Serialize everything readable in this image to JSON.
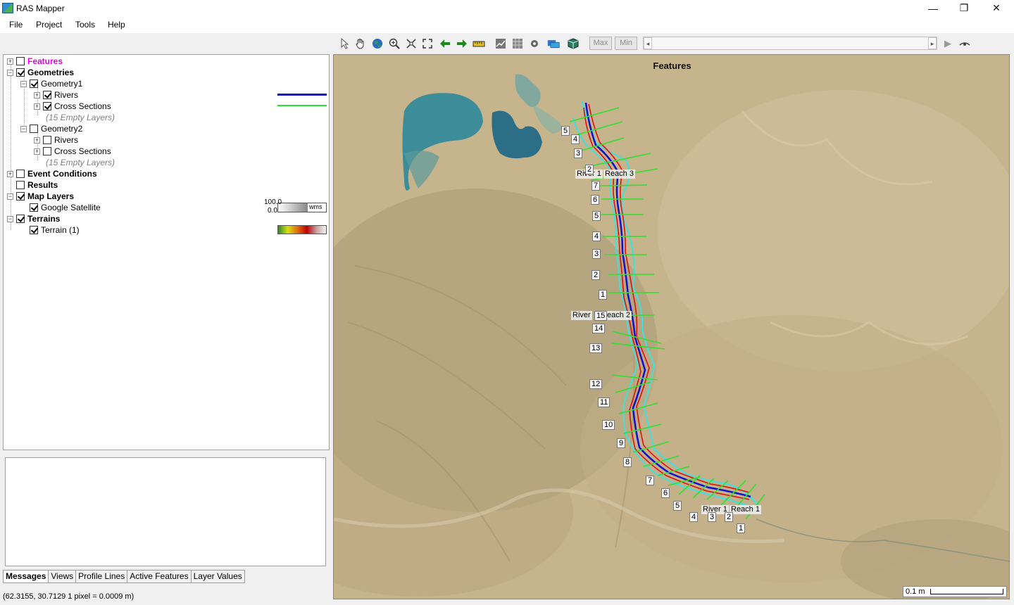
{
  "window": {
    "title": "RAS Mapper",
    "minimize": "—",
    "maximize": "❐",
    "close": "✕"
  },
  "menu": [
    "File",
    "Project",
    "Tools",
    "Help"
  ],
  "toolbar": {
    "max_label": "Max",
    "min_label": "Min",
    "icons": [
      "pointer-icon",
      "pan-hand-icon",
      "globe-icon",
      "zoom-in-icon",
      "zoom-extents-icon",
      "full-extent-icon",
      "back-arrow-icon",
      "forward-arrow-icon",
      "measure-icon",
      "profile-icon",
      "raster-icon",
      "settings-icon",
      "layer-icon",
      "cube-icon"
    ]
  },
  "tree": {
    "features": "Features",
    "geometries": "Geometries",
    "geometry1": "Geometry1",
    "g1_rivers": "Rivers",
    "g1_cross_sections": "Cross Sections",
    "g1_empty": "(15 Empty Layers)",
    "geometry2": "Geometry2",
    "g2_rivers": "Rivers",
    "g2_cross_sections": "Cross Sections",
    "g2_empty": "(15 Empty Layers)",
    "event_conditions": "Event Conditions",
    "results": "Results",
    "map_layers": "Map Layers",
    "google_satellite": "Google Satellite",
    "terrains": "Terrains",
    "terrain1": "Terrain (1)",
    "wms_top": "100.0",
    "wms_bottom": "0.0",
    "wms_label": "wms",
    "rivers_color": "#1010d0",
    "cross_sections_color": "#30e030"
  },
  "tabs": [
    "Messages",
    "Views",
    "Profile Lines",
    "Active Features",
    "Layer Values"
  ],
  "status": "(62.3155, 30.7129  1 pixel = 0.0009 m)",
  "map": {
    "title": "Features",
    "scale_label": "0.1 m",
    "reach_labels": [
      "River 1",
      "Reach 3",
      "River",
      "each 2",
      "River 1",
      "Reach 1"
    ],
    "xs_reach3": [
      "5",
      "4",
      "3",
      "2"
    ],
    "xs_reach2": [
      "7",
      "6",
      "5",
      "4",
      "3",
      "2",
      "1",
      "15",
      "14",
      "13",
      "12",
      "11",
      "10",
      "9",
      "8",
      "7",
      "6",
      "5",
      "4"
    ],
    "xs_reach1": [
      "3",
      "2",
      "1"
    ]
  }
}
